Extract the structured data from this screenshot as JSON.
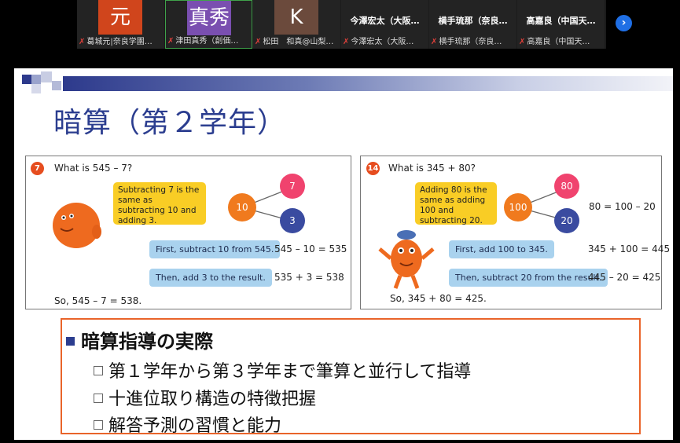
{
  "participants": [
    {
      "avatar": "元",
      "avatar_color": "#d0451c",
      "name": "葛城元|奈良学園…",
      "muted": true,
      "active": false
    },
    {
      "avatar": "真秀",
      "avatar_color": "#7a4fb0",
      "name": "津田真秀（創価…",
      "muted": true,
      "active": true
    },
    {
      "avatar": "K",
      "avatar_color": "#6b4a3c",
      "name": "松田　和真@山梨…",
      "muted": true,
      "active": false
    },
    {
      "title": "今澤宏太（大阪…",
      "name": "今澤宏太（大阪…",
      "muted": true,
      "active": false
    },
    {
      "title": "横手琉那（奈良…",
      "name": "横手琉那（奈良…",
      "muted": true,
      "active": false
    },
    {
      "title": "高嘉良（中国天…",
      "name": "高嘉良（中国天…",
      "muted": true,
      "active": false
    }
  ],
  "next_button_glyph": "›",
  "slide": {
    "title": "暗算（第２学年）",
    "left_panel": {
      "number": "7",
      "question": "What is 545 – 7?",
      "bubble": "Subtracting 7 is the same as subtracting 10 and adding 3.",
      "tree": {
        "root": "10",
        "top": "7",
        "bottom": "3"
      },
      "step1": "First, subtract 10 from 545.",
      "eq1": "545 – 10 = 535",
      "step2": "Then, add 3 to the result.",
      "eq2": "535 + 3 = 538",
      "conclusion": "So, 545 – 7 = 538."
    },
    "right_panel": {
      "number": "14",
      "question": "What is 345 + 80?",
      "bubble": "Adding 80 is the same as adding 100 and subtracting 20.",
      "tree": {
        "root": "100",
        "top": "80",
        "bottom": "20"
      },
      "side_eq": "80 = 100 – 20",
      "step1": "First, add 100 to 345.",
      "eq1": "345 + 100 = 445",
      "step2": "Then, subtract 20 from the result.",
      "eq2": "445 – 20 = 425",
      "conclusion": "So, 345 + 80 = 425."
    },
    "summary": {
      "heading": "暗算指導の実際",
      "items": [
        "第１学年から第３学年まで筆算と並行して指導",
        "十進位取り構造の特徴把握",
        "解答予測の習慣と能力"
      ]
    }
  },
  "colors": {
    "title": "#2b3d8f",
    "accent_orange": "#e64d1f",
    "bubble_yellow": "#f9cd25",
    "step_blue": "#a9d2ee",
    "summary_border": "#e9642a",
    "circle_pink": "#f0436e",
    "circle_orange": "#f07a1e",
    "circle_navy": "#3a4ba0"
  }
}
